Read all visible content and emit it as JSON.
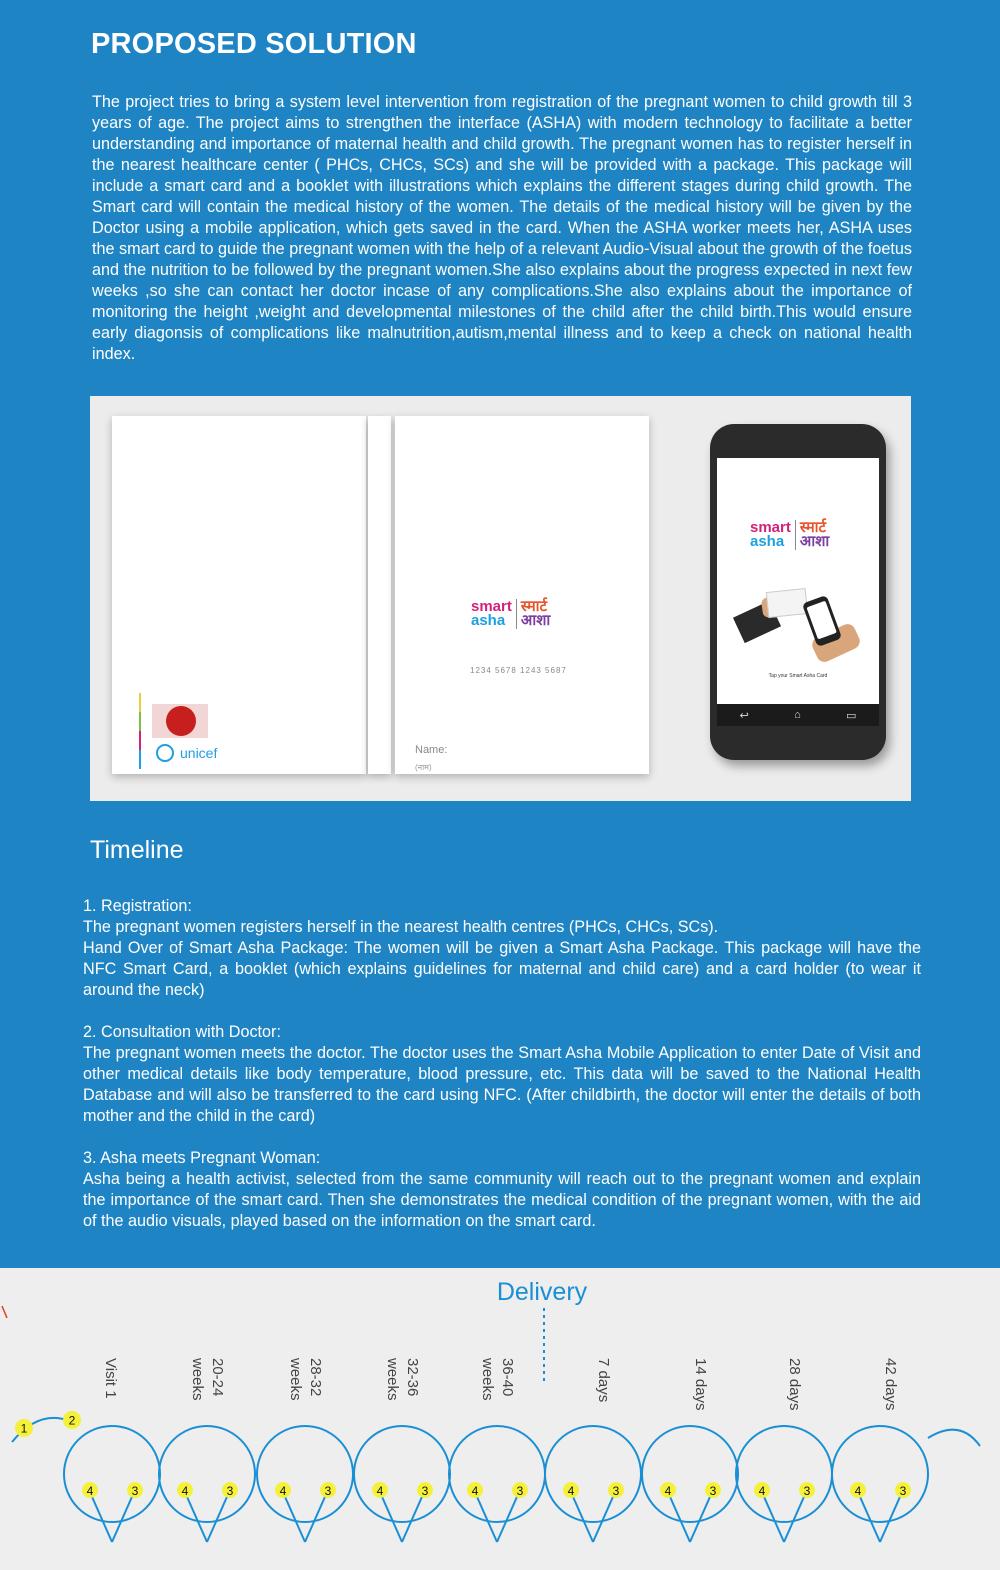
{
  "title": "PROPOSED SOLUTION",
  "intro": "The project tries to bring a system level intervention from registration of the pregnant women to child growth till 3 years of age. The project aims to strengthen the interface (ASHA) with modern technology to facilitate a better understanding and importance of maternal health and child growth. The pregnant women has to register herself in the nearest healthcare center ( PHCs, CHCs, SCs) and she will be provided with a package. This package will include a smart card and a booklet with illustrations which explains the different stages during child growth. The Smart card will contain the medical history of the women. The details of the medical history will be given by the Doctor using a mobile application, which gets saved in the card. When the ASHA worker meets her, ASHA uses the smart card to guide the pregnant women with the help of a relevant Audio-Visual about the growth of the foetus and the nutrition to be followed by the pregnant women.She also explains about the progress expected in next few weeks ,so she can contact her doctor incase of any complications.She also explains about the importance of monitoring the height ,weight and developmental milestones of the child after the child birth.This would ensure early diagonsis of complications like malnutrition,autism,mental illness and to keep a check on national health index.",
  "mockup": {
    "unicef": "unicef",
    "logo_en_1": "smart",
    "logo_en_2": "asha",
    "logo_hi_1": "स्मार्ट",
    "logo_hi_2": "आशा",
    "card_number": "1234 5678 1243 5687",
    "name_label": "Name:",
    "name_label_hi": "(नाम)",
    "phone_caption": "Tap your Smart Asha Card"
  },
  "timeline_heading": "Timeline",
  "timeline": [
    {
      "heading": "1. Registration:",
      "lines": [
        "The pregnant women registers herself in the nearest health centres (PHCs, CHCs, SCs).",
        "Hand Over of Smart Asha Package: The women will be given a Smart Asha Package. This package will have the NFC Smart Card, a booklet (which explains guidelines for maternal and child care) and a card holder (to wear it around the neck)"
      ]
    },
    {
      "heading": "2. Consultation with Doctor:",
      "lines": [
        "The pregnant women meets the doctor. The doctor uses the Smart Asha Mobile Application to enter Date of Visit and other medical details like body temperature, blood pressure, etc. This data will be saved to the National Health Database and will also be transferred to the card using NFC. (After childbirth, the doctor will enter the details of both mother and the child in the card)"
      ]
    },
    {
      "heading": "3. Asha meets Pregnant Woman:",
      "lines": [
        "Asha being a health activist, selected from the same community will reach out to the pregnant women and explain the importance of the smart card. Then she demonstrates the medical condition of the pregnant women, with the aid of the audio visuals, played based on the information on the smart card."
      ]
    }
  ],
  "diagram": {
    "delivery_label": "Delivery",
    "stages": [
      [
        "Visit 1"
      ],
      [
        "20-24",
        "weeks"
      ],
      [
        "28-32",
        "weeks"
      ],
      [
        "32-36",
        "weeks"
      ],
      [
        "36-40",
        "weeks"
      ],
      [
        "7 days"
      ],
      [
        "14 days"
      ],
      [
        "28 days"
      ],
      [
        "42 days"
      ]
    ],
    "start_markers": [
      "1",
      "2"
    ],
    "loop_markers": [
      "4",
      "3"
    ],
    "line_color": "#1a8fd4",
    "marker_color": "#f5f13a"
  }
}
